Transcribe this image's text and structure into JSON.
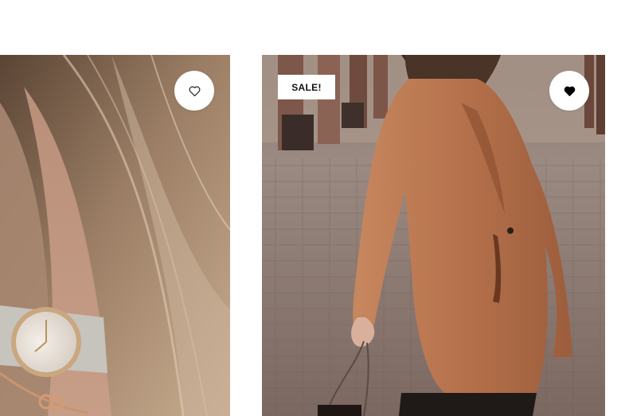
{
  "products": [
    {
      "image": "wrist-watch-photo",
      "wishlisted": false
    },
    {
      "image": "camel-coat-photo",
      "wishlisted": true,
      "badge": "SALE!"
    }
  ],
  "colors": {
    "badge_bg": "#ffffff",
    "badge_text": "#111111",
    "heart_filled": "#000000",
    "heart_outline": "#222222"
  },
  "icons": {
    "wishlist_empty": "heart-outline-icon",
    "wishlist_filled": "heart-filled-icon"
  }
}
